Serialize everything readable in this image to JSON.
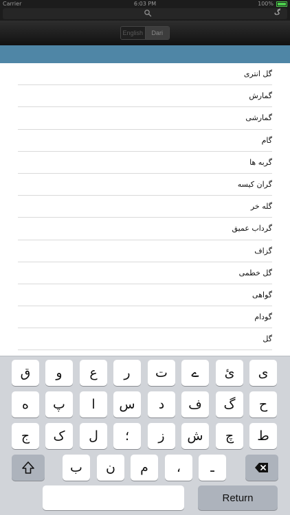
{
  "status_bar": {
    "carrier": "Carrier",
    "time": "6:03 PM",
    "battery": "100%"
  },
  "search": {
    "query": "گ"
  },
  "language_toggle": {
    "english": "English",
    "dari": "Dari",
    "selected": "Dari"
  },
  "words": [
    "گل انتری",
    "گمارش",
    "گمارشی",
    "گام",
    "گربه ها",
    "گران کیسه",
    "گله خر",
    "گرداب عمیق",
    "گزاف",
    "گل خطمی",
    "گواهی",
    "گودام",
    "گل"
  ],
  "keyboard": {
    "row1": [
      "ی",
      "ئ",
      "ے",
      "ت",
      "ر",
      "ع",
      "و",
      "ق"
    ],
    "row2": [
      "ح",
      "گ",
      "ف",
      "د",
      "س",
      "ا",
      "پ",
      "ه"
    ],
    "row3": [
      "ط",
      "چ",
      "ش",
      "ز",
      "؛",
      "ل",
      "ک",
      "ج"
    ],
    "row4": [
      "ـ",
      "،",
      "م",
      "ن",
      "ب"
    ],
    "shift_icon": "shift-icon",
    "backspace_icon": "backspace-icon",
    "return_label": "Return"
  },
  "colors": {
    "header_blue": "#4f86a6",
    "keyboard_bg": "#d1d4d9",
    "battery_green": "#4ccf4c"
  }
}
